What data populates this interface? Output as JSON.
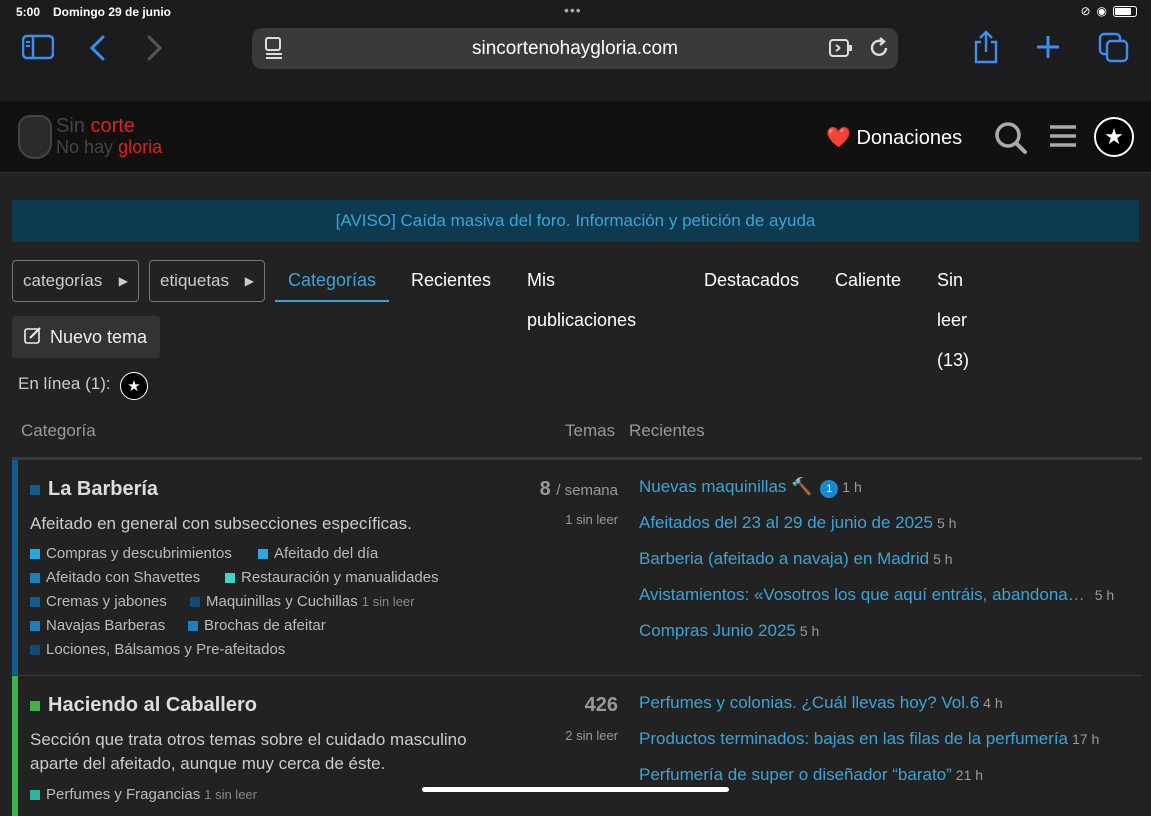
{
  "status": {
    "time": "5:00",
    "date": "Domingo 29 de junio"
  },
  "browser": {
    "url": "sincortenohaygloria.com"
  },
  "site": {
    "logo_line1_a": "Sin",
    "logo_line1_b": "corte",
    "logo_line2_a": "No hay",
    "logo_line2_b": "gloria",
    "donaciones": "Donaciones",
    "donaciones_icon": "❤️"
  },
  "banner": "[AVISO] Caída masiva del foro. Información y petición de ayuda",
  "nav": {
    "categorias_dd": "categorías",
    "etiquetas_dd": "etiquetas",
    "tabs": [
      "Categorías",
      "Recientes",
      "Mis publicaciones",
      "Destacados",
      "Caliente",
      "Sin leer (13)"
    ]
  },
  "new_topic": "Nuevo tema",
  "online": "En línea (1):",
  "columns": {
    "category": "Categoría",
    "topics": "Temas",
    "recent": "Recientes"
  },
  "categories": [
    {
      "name": "La Barbería",
      "color": "#0f5e8e",
      "description": "Afeitado en general con subsecciones específicas.",
      "count": "8",
      "count_suffix": "/ semana",
      "unread": "1 sin leer",
      "subcats": [
        {
          "name": "Compras y descubrimientos",
          "color": "#25a9e0",
          "unread": ""
        },
        {
          "name": "Afeitado del día",
          "color": "#25a9e0",
          "unread": ""
        },
        {
          "name": "Afeitado con Shavettes",
          "color": "#1b7fc4",
          "unread": ""
        },
        {
          "name": "Restauración y manualidades",
          "color": "#3fd4c4",
          "unread": ""
        },
        {
          "name": "Cremas y jabones",
          "color": "#0f5e8e",
          "unread": ""
        },
        {
          "name": "Maquinillas y Cuchillas",
          "color": "#0f4a78",
          "unread": "1 sin leer"
        },
        {
          "name": "Navajas Barberas",
          "color": "#1b7fc4",
          "unread": ""
        },
        {
          "name": "Brochas de afeitar",
          "color": "#1b7fc4",
          "unread": ""
        },
        {
          "name": "Lociones, Bálsamos y Pre-afeitados",
          "color": "#0f4a78",
          "unread": ""
        }
      ],
      "topics": [
        {
          "title": "Nuevas maquinillas 🔨",
          "badge": "1",
          "age": "1 h"
        },
        {
          "title": "Afeitados del 23 al 29 de junio de 2025",
          "badge": "",
          "age": "5 h"
        },
        {
          "title": "Barberia (afeitado a navaja) en Madrid",
          "badge": "",
          "age": "5 h"
        },
        {
          "title": "Avistamientos: «Vosotros los que aquí entráis, abandona…",
          "badge": "",
          "age": "5 h"
        },
        {
          "title": "Compras Junio 2025",
          "badge": "",
          "age": "5 h"
        }
      ]
    },
    {
      "name": "Haciendo al Caballero",
      "color": "#3ab54a",
      "description": "Sección que trata otros temas sobre el cuidado masculino aparte del afeitado, aunque muy cerca de éste.",
      "count": "426",
      "count_suffix": "",
      "unread": "2 sin leer",
      "subcats": [
        {
          "name": "Perfumes y Fragancias",
          "color": "#2bb59a",
          "unread": "1 sin leer"
        }
      ],
      "topics": [
        {
          "title": "Perfumes y colonias. ¿Cuál llevas hoy? Vol.6",
          "badge": "",
          "age": "4 h"
        },
        {
          "title": "Productos terminados: bajas en las filas de la perfumería",
          "badge": "",
          "age": "17 h"
        },
        {
          "title": "Perfumería de super o diseñador “barato”",
          "badge": "",
          "age": "21 h"
        }
      ]
    }
  ]
}
